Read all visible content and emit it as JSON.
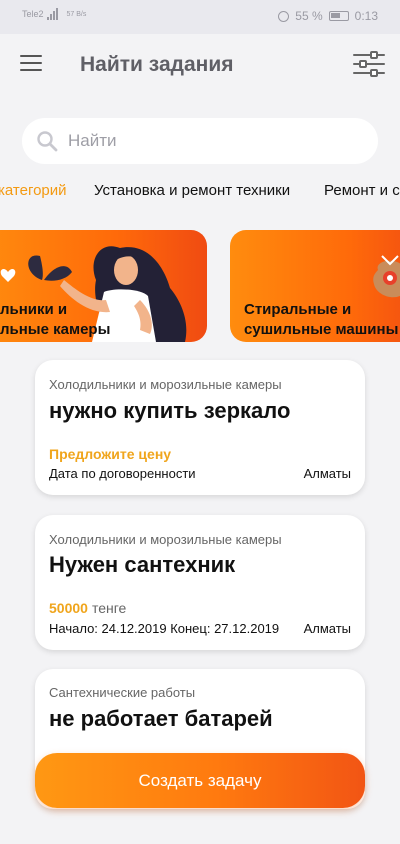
{
  "status_bar": {
    "carrier": "Tele2",
    "network": "57 B/s",
    "battery": "55 %",
    "time": "0:13"
  },
  "header": {
    "title": "Найти задания"
  },
  "search": {
    "placeholder": "Найти"
  },
  "tabs": [
    {
      "label": "категорий",
      "active": true
    },
    {
      "label": "Установка и ремонт техники",
      "active": false
    },
    {
      "label": "Ремонт и с",
      "active": false
    }
  ],
  "banners": [
    {
      "line1": "льники и",
      "line2": "льные камеры"
    },
    {
      "line1": "Стиральные и",
      "line2": "сушильные машины"
    }
  ],
  "tasks": [
    {
      "category": "Холодильники и морозильные камеры",
      "title": "нужно купить зеркало",
      "price": "Предложите цену",
      "price_unit": "",
      "dates": "Дата по договоренности",
      "city": "Алматы"
    },
    {
      "category": "Холодильники и морозильные камеры",
      "title": "Нужен сантехник",
      "price": "50000",
      "price_unit": "тенге",
      "dates": "Начало: 24.12.2019  Конец: 27.12.2019",
      "city": "Алматы"
    },
    {
      "category": "Сантехнические работы",
      "title": "не работает батарей"
    }
  ],
  "create_button": {
    "label": "Создать задачу"
  },
  "colors": {
    "accent": "#f39a12",
    "price": "#f0a51c",
    "gradient_start": "#ff9813",
    "gradient_end": "#f25514"
  }
}
